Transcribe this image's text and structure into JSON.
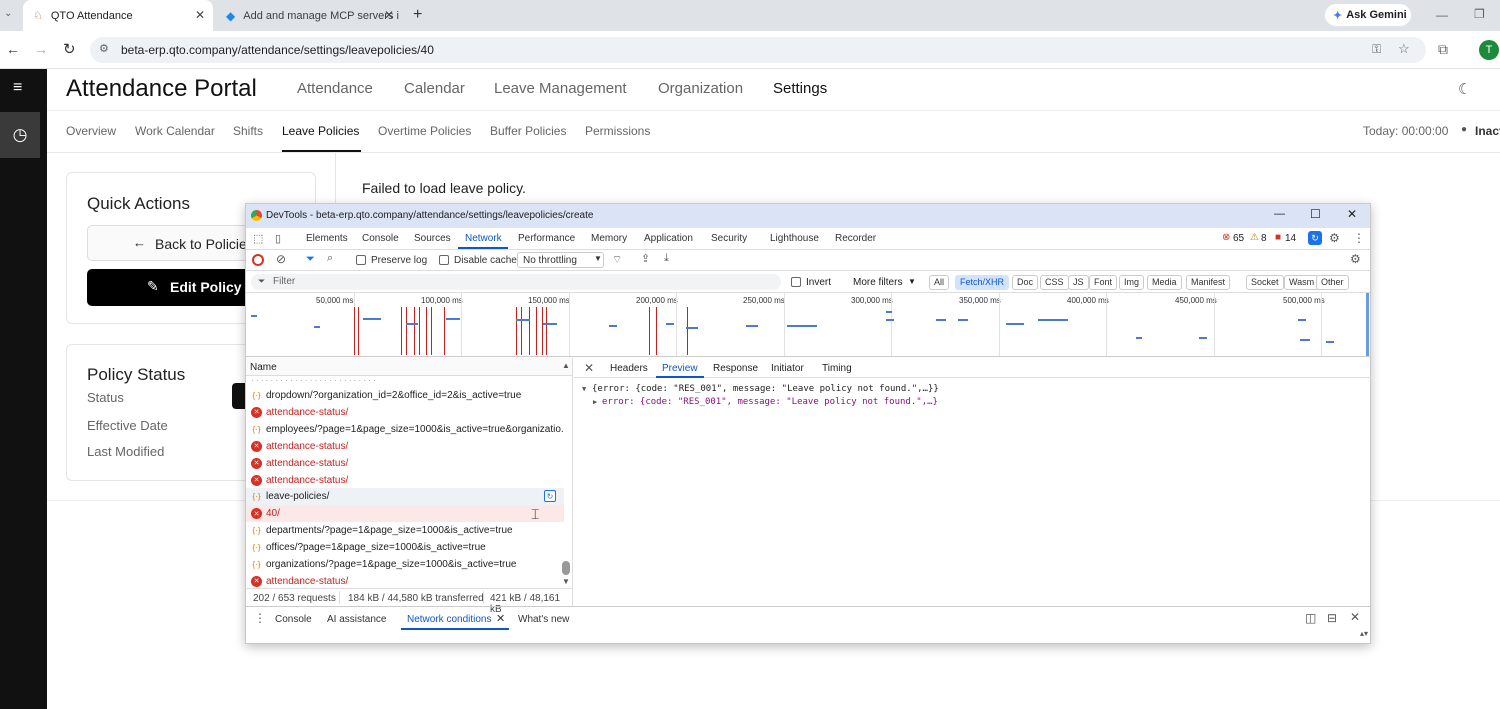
{
  "browser": {
    "tabs": [
      {
        "title": "QTO Attendance"
      },
      {
        "title": "Add and manage MCP servers i"
      }
    ],
    "url": "beta-erp.qto.company/attendance/settings/leavepolicies/40",
    "ask_gemini": "Ask Gemini",
    "profile_initial": "T"
  },
  "app": {
    "title": "Attendance Portal",
    "top_nav": [
      "Attendance",
      "Calendar",
      "Leave Management",
      "Organization",
      "Settings"
    ],
    "active_top": "Settings",
    "sub_nav": [
      "Overview",
      "Work Calendar",
      "Shifts",
      "Leave Policies",
      "Overtime Policies",
      "Buffer Policies",
      "Permissions"
    ],
    "active_sub": "Leave Policies",
    "today": "Today: 00:00:00",
    "status_short": "Inact",
    "error_message": "Failed to load leave policy.",
    "quick_actions": {
      "title": "Quick Actions",
      "back": "Back to Policies",
      "edit": "Edit Policy"
    },
    "policy_status": {
      "title": "Policy Status",
      "rows": [
        "Status",
        "Effective Date",
        "Last Modified"
      ]
    }
  },
  "devtools": {
    "title": "DevTools - beta-erp.qto.company/attendance/settings/leavepolicies/create",
    "tabs": [
      "Elements",
      "Console",
      "Sources",
      "Network",
      "Performance",
      "Memory",
      "Application",
      "Security",
      "Lighthouse",
      "Recorder"
    ],
    "active_tab": "Network",
    "counts": {
      "errors": "65",
      "warnings": "8",
      "issues": "14"
    },
    "toolbar": {
      "preserve_log": "Preserve log",
      "disable_cache": "Disable cache",
      "throttling": "No throttling"
    },
    "filter": {
      "placeholder": "Filter",
      "invert": "Invert",
      "more_filters": "More filters",
      "types": [
        "All",
        "Fetch/XHR",
        "Doc",
        "CSS",
        "JS",
        "Font",
        "Img",
        "Media",
        "Manifest",
        "Socket",
        "Wasm",
        "Other"
      ],
      "selected": "Fetch/XHR"
    },
    "timeline_ticks": [
      "50,000 ms",
      "100,000 ms",
      "150,000 ms",
      "200,000 ms",
      "250,000 ms",
      "300,000 ms",
      "350,000 ms",
      "400,000 ms",
      "450,000 ms",
      "500,000 ms"
    ],
    "name_header": "Name",
    "requests": [
      {
        "name": "dropdown/?organization_id=2&office_id=2&is_active=true",
        "error": false
      },
      {
        "name": "attendance-status/",
        "error": true
      },
      {
        "name": "employees/?page=1&page_size=1000&is_active=true&organizatio...",
        "error": false
      },
      {
        "name": "attendance-status/",
        "error": true
      },
      {
        "name": "attendance-status/",
        "error": true
      },
      {
        "name": "attendance-status/",
        "error": true
      },
      {
        "name": "leave-policies/",
        "error": false
      },
      {
        "name": "40/",
        "error": true
      },
      {
        "name": "departments/?page=1&page_size=1000&is_active=true",
        "error": false
      },
      {
        "name": "offices/?page=1&page_size=1000&is_active=true",
        "error": false
      },
      {
        "name": "organizations/?page=1&page_size=1000&is_active=true",
        "error": false
      },
      {
        "name": "attendance-status/",
        "error": true
      }
    ],
    "detail_tabs": [
      "Headers",
      "Preview",
      "Response",
      "Initiator",
      "Timing"
    ],
    "active_detail_tab": "Preview",
    "preview_lines": [
      "{error: {code: \"RES_001\", message: \"Leave policy not found.\",…}}",
      "error: {code: \"RES_001\", message: \"Leave policy not found.\",…}"
    ],
    "status": {
      "requests": "202 / 653 requests",
      "transferred": "184 kB / 44,580 kB transferred",
      "resources": "421 kB / 48,161 kB"
    },
    "drawer_tabs": [
      "Console",
      "AI assistance",
      "Network conditions",
      "What's new"
    ],
    "active_drawer_tab": "Network conditions"
  }
}
